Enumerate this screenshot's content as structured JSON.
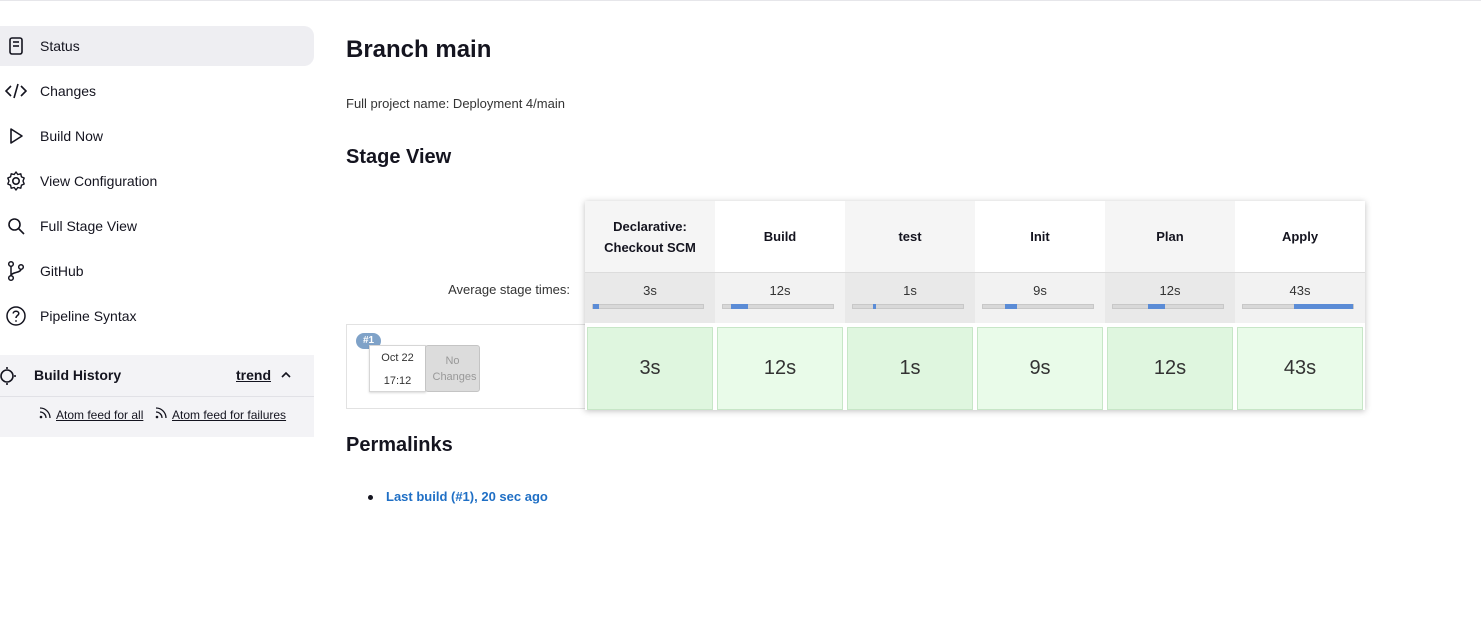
{
  "sidebar": {
    "items": [
      {
        "label": "Status",
        "icon": "document-icon",
        "active": true
      },
      {
        "label": "Changes",
        "icon": "code-icon"
      },
      {
        "label": "Build Now",
        "icon": "play-icon"
      },
      {
        "label": "View Configuration",
        "icon": "gear-icon"
      },
      {
        "label": "Full Stage View",
        "icon": "search-icon"
      },
      {
        "label": "GitHub",
        "icon": "branch-icon"
      },
      {
        "label": "Pipeline Syntax",
        "icon": "help-icon"
      }
    ],
    "build_history": {
      "title": "Build History",
      "trend": "trend",
      "feed_all": "Atom feed for all",
      "feed_failures": "Atom feed for failures"
    }
  },
  "main": {
    "title": "Branch main",
    "full_project_name": "Full project name: Deployment 4/main",
    "stage_view_title": "Stage View",
    "avg_label": "Average stage times:",
    "stages": [
      {
        "name": "Declarative: Checkout SCM",
        "avg": "3s",
        "fill_fraction": 0.05,
        "run": "3s"
      },
      {
        "name": "Build",
        "avg": "12s",
        "fill_fraction": 0.15,
        "run": "12s"
      },
      {
        "name": "test",
        "avg": "1s",
        "fill_fraction": 0.02,
        "run": "1s"
      },
      {
        "name": "Init",
        "avg": "9s",
        "fill_fraction": 0.11,
        "run": "9s"
      },
      {
        "name": "Plan",
        "avg": "12s",
        "fill_fraction": 0.15,
        "run": "12s"
      },
      {
        "name": "Apply",
        "avg": "43s",
        "fill_fraction": 0.54,
        "run": "43s"
      }
    ],
    "build": {
      "number": "#1",
      "date": "Oct 22",
      "time": "17:12",
      "changes": "No Changes"
    },
    "permalinks_title": "Permalinks",
    "permalinks": [
      "Last build (#1), 20 sec ago"
    ]
  },
  "colors": {
    "success_cell_a": "#dff6df",
    "success_cell_b": "#e9fbe9",
    "link": "#1f6fc5",
    "badge": "#7fa2c8"
  }
}
